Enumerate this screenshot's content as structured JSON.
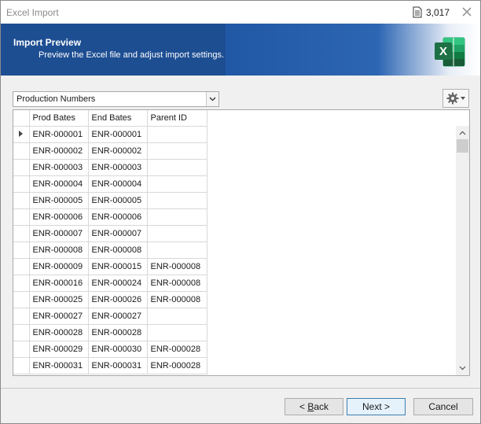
{
  "window": {
    "title": "Excel Import",
    "doc_count": "3,017"
  },
  "banner": {
    "title": "Import Preview",
    "subtitle": "Preview the Excel file and adjust import settings.",
    "logo_letter": "X"
  },
  "sheet_select": {
    "value": "Production Numbers"
  },
  "grid": {
    "columns": [
      "Prod Bates",
      "End Bates",
      "Parent ID"
    ],
    "rows": [
      [
        "ENR-000001",
        "ENR-000001",
        ""
      ],
      [
        "ENR-000002",
        "ENR-000002",
        ""
      ],
      [
        "ENR-000003",
        "ENR-000003",
        ""
      ],
      [
        "ENR-000004",
        "ENR-000004",
        ""
      ],
      [
        "ENR-000005",
        "ENR-000005",
        ""
      ],
      [
        "ENR-000006",
        "ENR-000006",
        ""
      ],
      [
        "ENR-000007",
        "ENR-000007",
        ""
      ],
      [
        "ENR-000008",
        "ENR-000008",
        ""
      ],
      [
        "ENR-000009",
        "ENR-000015",
        "ENR-000008"
      ],
      [
        "ENR-000016",
        "ENR-000024",
        "ENR-000008"
      ],
      [
        "ENR-000025",
        "ENR-000026",
        "ENR-000008"
      ],
      [
        "ENR-000027",
        "ENR-000027",
        ""
      ],
      [
        "ENR-000028",
        "ENR-000028",
        ""
      ],
      [
        "ENR-000029",
        "ENR-000030",
        "ENR-000028"
      ],
      [
        "ENR-000031",
        "ENR-000031",
        "ENR-000028"
      ]
    ]
  },
  "footer": {
    "back_prefix": "< ",
    "back_mnemonic": "B",
    "back_rest": "ack",
    "next": "Next >",
    "cancel": "Cancel"
  },
  "colors": {
    "banner": "#1d4e92",
    "excel_green": "#1e7145"
  }
}
